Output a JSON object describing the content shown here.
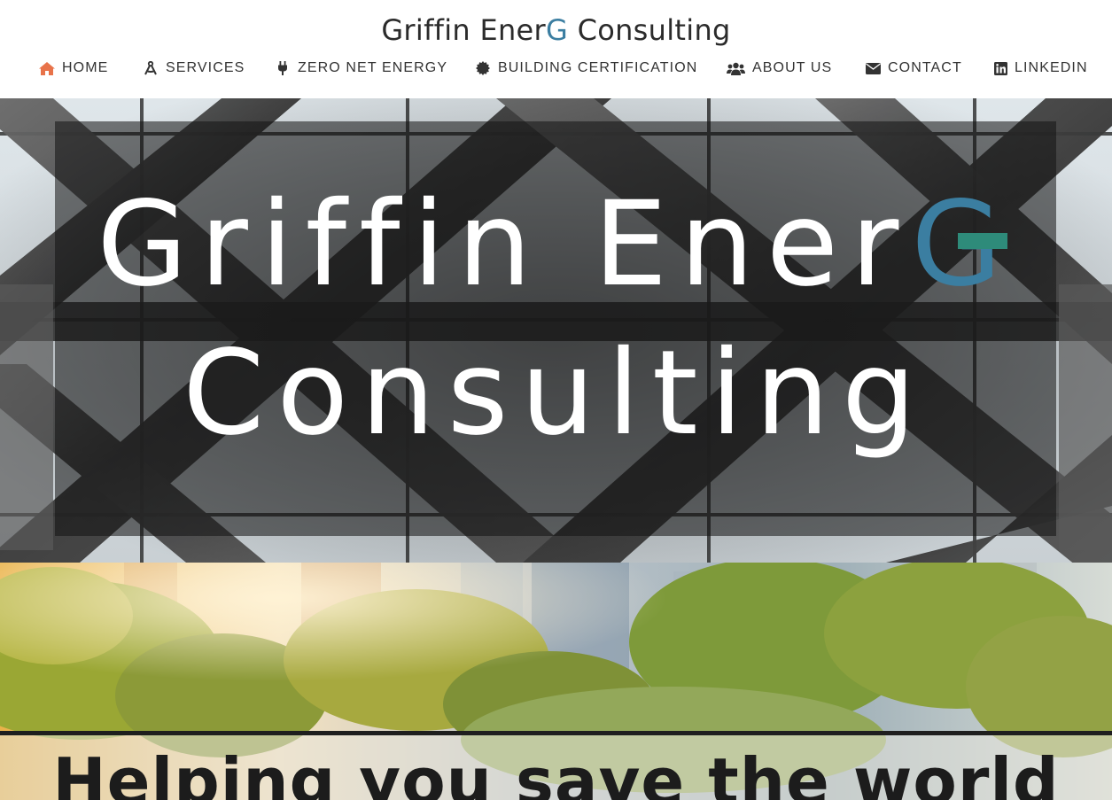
{
  "header": {
    "logo": {
      "part1": "Griffin Ener",
      "accent": "G",
      "part2": " Consulting"
    },
    "nav": [
      {
        "label": "HOME",
        "icon": "home-icon",
        "active": true
      },
      {
        "label": "SERVICES",
        "icon": "drafting-compass-icon"
      },
      {
        "label": "ZERO NET ENERGY",
        "icon": "plug-icon"
      },
      {
        "label": "BUILDING CERTIFICATION",
        "icon": "certificate-icon"
      },
      {
        "label": "ABOUT US",
        "icon": "users-icon"
      },
      {
        "label": "CONTACT",
        "icon": "envelope-icon"
      },
      {
        "label": "LINKEDIN",
        "icon": "linkedin-icon"
      }
    ]
  },
  "hero": {
    "line1_main": "Griffin Ener",
    "line1_accent": "G",
    "line2": "Consulting"
  },
  "section2": {
    "tagline": "Helping you save the world"
  },
  "colors": {
    "accent_blue": "#3b7ea1",
    "accent_green": "#2e8b7a",
    "active_icon": "#e8734a",
    "text_dark": "#333333"
  }
}
